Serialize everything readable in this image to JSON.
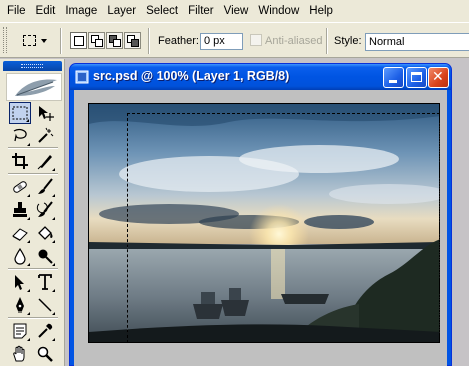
{
  "menubar": {
    "items": [
      "File",
      "Edit",
      "Image",
      "Layer",
      "Select",
      "Filter",
      "View",
      "Window",
      "Help"
    ]
  },
  "options": {
    "tool_preset_icon": "rectangular-marquee-icon",
    "selection_modes": [
      "new-selection-icon",
      "add-to-selection-icon",
      "subtract-from-selection-icon",
      "intersect-selection-icon"
    ],
    "feather_label": "Feather:",
    "feather_value": "0 px",
    "antialias_label": "Anti-aliased",
    "style_label": "Style:",
    "style_value": "Normal"
  },
  "toolbox": {
    "tools": [
      "rectangular-marquee-icon",
      "move-icon",
      "lasso-icon",
      "magic-wand-icon",
      "crop-icon",
      "slice-icon",
      "healing-brush-icon",
      "brush-icon",
      "clone-stamp-icon",
      "history-brush-icon",
      "eraser-icon",
      "paint-bucket-icon",
      "blur-icon",
      "dodge-icon",
      "path-selection-icon",
      "type-icon",
      "pen-icon",
      "line-icon",
      "notes-icon",
      "eyedropper-icon",
      "hand-icon",
      "zoom-icon"
    ]
  },
  "document": {
    "title": "src.psd @ 100% (Layer 1, RGB/8)"
  },
  "colors": {
    "titlebar": "#0054e3",
    "close_button": "#d9431b",
    "chrome": "#ece9d8"
  }
}
